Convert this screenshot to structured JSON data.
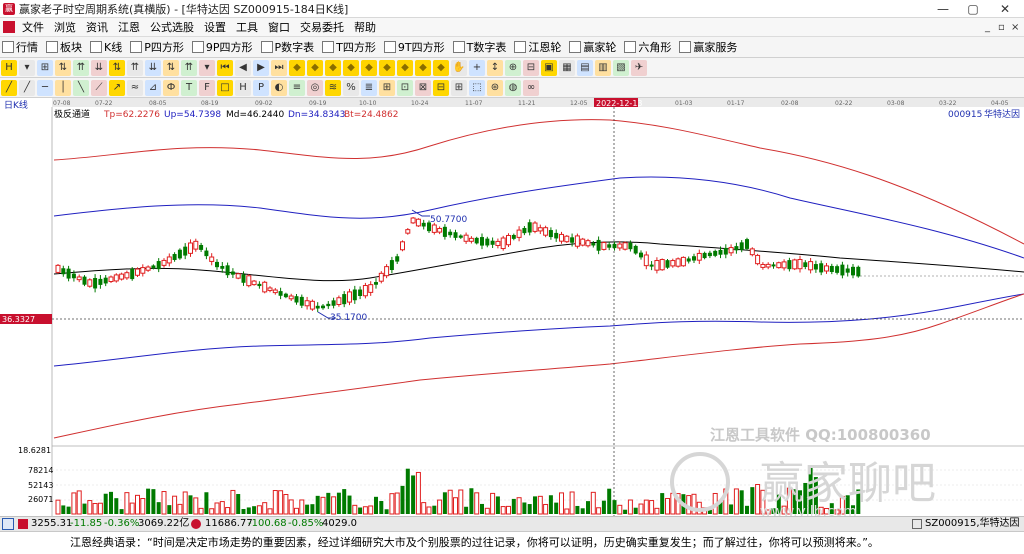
{
  "window": {
    "title": "赢家老子时空周期系统(真横版) - [华特达因 SZ000915-184日K线]",
    "controls": [
      "—",
      "▢",
      "✕"
    ]
  },
  "menu": {
    "items": [
      "文件",
      "浏览",
      "资讯",
      "江恩",
      "公式选股",
      "设置",
      "工具",
      "窗口",
      "交易委托",
      "帮助"
    ],
    "right": [
      "_",
      "▫",
      "×"
    ]
  },
  "toolbar1": {
    "items": [
      {
        "label": "行情",
        "icon": "grid-icon"
      },
      {
        "label": "板块",
        "icon": "blocks-icon"
      },
      {
        "label": "K线",
        "icon": "kline-icon"
      },
      {
        "label": "P四方形",
        "icon": "square-icon"
      },
      {
        "label": "9P四方形",
        "icon": "square-icon"
      },
      {
        "label": "P数字表",
        "icon": "table-icon"
      },
      {
        "label": "T四方形",
        "icon": "square-icon"
      },
      {
        "label": "9T四方形",
        "icon": "square-icon"
      },
      {
        "label": "T数字表",
        "icon": "table-icon"
      },
      {
        "label": "江恩轮",
        "icon": "wheel-icon"
      },
      {
        "label": "赢家轮",
        "icon": "wheel-icon"
      },
      {
        "label": "六角形",
        "icon": "hexagon-icon"
      },
      {
        "label": "赢家服务",
        "icon": "dollar-icon"
      }
    ]
  },
  "toolbar2": {
    "glyphs": [
      "H",
      "▾",
      "⊞",
      "⇅",
      "⇈",
      "⇊",
      "⇅",
      "⇈",
      "⇊",
      "⇅",
      "⇈",
      "▾",
      "⏮",
      "◀",
      "▶",
      "⏭",
      "◆",
      "◆",
      "◆",
      "◆",
      "◆",
      "◆",
      "◆",
      "◆",
      "◆",
      "✋",
      "+",
      "↕",
      "⊕",
      "⊟",
      "▣",
      "▦",
      "▤",
      "▥",
      "▧",
      "✈"
    ]
  },
  "toolbar3": {
    "glyphs": [
      "╱",
      "╱",
      "─",
      "│",
      "╲",
      "⟋",
      "↗",
      "≈",
      "⊿",
      "Ф",
      "T",
      "F",
      "□",
      "H",
      "P",
      "◐",
      "≡",
      "◎",
      "≋",
      "%",
      "≣",
      "⊞",
      "⊡",
      "⊠",
      "⊟",
      "⊞",
      "⬚",
      "⊛",
      "◍",
      "∞"
    ]
  },
  "chart": {
    "period_label": "日K线",
    "indicator_name": "极反通道",
    "indicators": [
      {
        "label": "Tp=62.2276",
        "color": "#d03030"
      },
      {
        "label": "Up=54.7398",
        "color": "#2020c0"
      },
      {
        "label": "Md=46.2440",
        "color": "#000000"
      },
      {
        "label": "Dn=34.8343",
        "color": "#2020c0"
      },
      {
        "label": "Bt=24.4862",
        "color": "#d03030"
      }
    ],
    "symbol": "000915",
    "name": "华特达因",
    "date_ticks": [
      "07-08",
      "07-22",
      "08-05",
      "08-19",
      "09-02",
      "09-19",
      "10-10",
      "10-24",
      "11-07",
      "11-21",
      "12-05",
      "2022-12-13",
      "01-03",
      "01-17",
      "02-08",
      "02-22",
      "03-08",
      "03-22",
      "04-05"
    ],
    "cursor_date": "2022-12-13",
    "price_label": "36.3327",
    "annotation_high": "50.7700",
    "annotation_low": "35.1700",
    "volume_axis": [
      "18.6281",
      "78214",
      "52143",
      "26071"
    ],
    "watermark_top": "江恩工具软件  QQ:100800360",
    "watermark_main": "赢家聊吧",
    "watermark_sub": "www.yjlb.com",
    "colors": {
      "up": "#e02020",
      "down": "#007a00",
      "tp_bt": "#d03030",
      "up_dn": "#2020c0",
      "md": "#000000"
    }
  },
  "chart_data": {
    "type": "candlestick",
    "series": [
      {
        "name": "Tp",
        "color": "#d03030"
      },
      {
        "name": "Up",
        "color": "#2020c0"
      },
      {
        "name": "Md",
        "color": "#000000"
      },
      {
        "name": "Dn",
        "color": "#2020c0"
      },
      {
        "name": "Bt",
        "color": "#d03030"
      }
    ],
    "current_values": {
      "Tp": 62.2276,
      "Up": 54.7398,
      "Md": 46.244,
      "Dn": 34.8343,
      "Bt": 24.4862
    },
    "marked_high": 50.77,
    "marked_low": 35.17,
    "x_ticks": [
      "07-08",
      "07-22",
      "08-05",
      "08-19",
      "09-02",
      "09-19",
      "10-10",
      "10-24",
      "11-07",
      "11-21",
      "12-05",
      "2022-12-13",
      "01-03",
      "01-17",
      "02-08",
      "02-22",
      "03-08",
      "03-22",
      "04-05"
    ],
    "volume_ticks": [
      78214,
      52143,
      26071
    ]
  },
  "status": {
    "index1_price": "3255.31",
    "index1_change": "-11.85",
    "index1_pct": "-0.36%",
    "index1_vol": "3069.22亿",
    "index2_price": "11686.77",
    "index2_change": "-100.68",
    "index2_pct": "-0.85%",
    "index2_vol": "4029.0",
    "right_code": "SZ000915,华特达因"
  },
  "ticker": {
    "text": "江恩经典语录：“时间是决定市场走势的重要因素，经过详细研究大市及个别股票的过往记录，你将可以证明，历史确实重复发生；而了解过往，你将可以预测将来。”。"
  }
}
